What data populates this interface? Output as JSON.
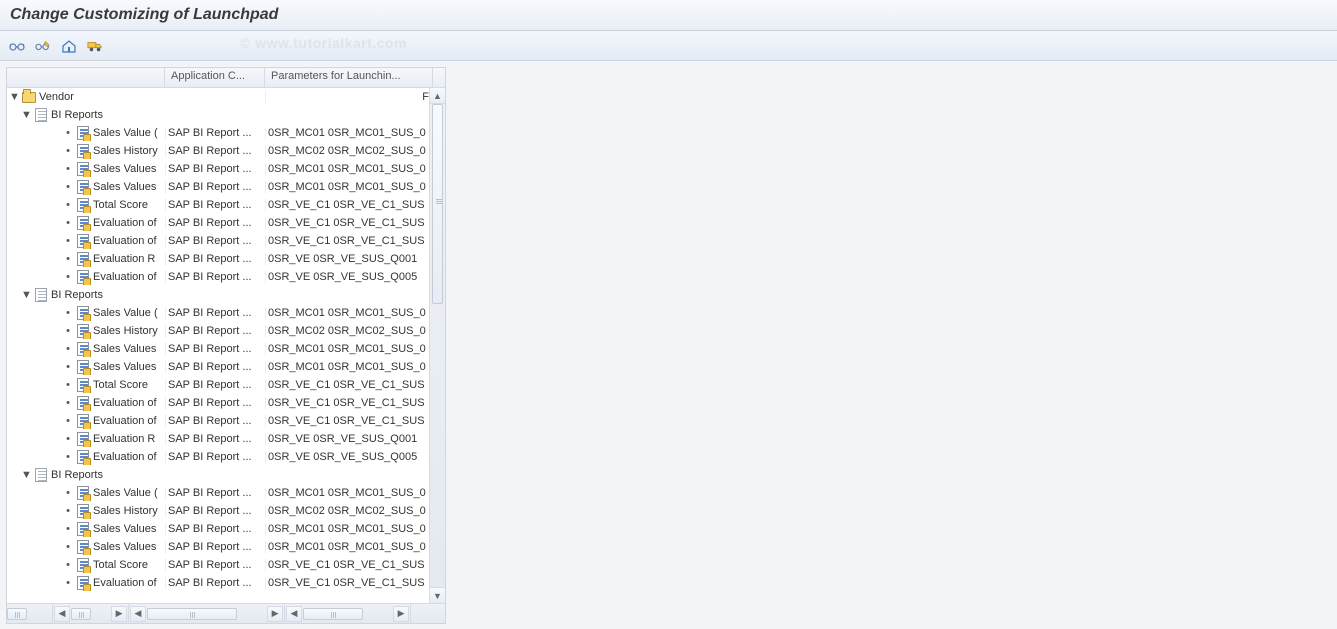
{
  "title": "Change Customizing of Launchpad",
  "watermark": "© www.tutorialkart.com",
  "toolbar_icons": [
    "glasses-icon",
    "glasses-pencil-icon",
    "house-icon",
    "truck-icon"
  ],
  "columns": {
    "c0": "",
    "c1": "Application C...",
    "c2": "Parameters for Launchin..."
  },
  "tree": {
    "root": {
      "label": "Vendor",
      "right": "F"
    },
    "groups": [
      {
        "label": "BI Reports",
        "items": [
          {
            "label": "Sales Value (",
            "app": "SAP BI Report ...",
            "param": "0SR_MC01 0SR_MC01_SUS_0"
          },
          {
            "label": "Sales History",
            "app": "SAP BI Report ...",
            "param": "0SR_MC02 0SR_MC02_SUS_0"
          },
          {
            "label": "Sales Values",
            "app": "SAP BI Report ...",
            "param": "0SR_MC01 0SR_MC01_SUS_0"
          },
          {
            "label": "Sales Values",
            "app": "SAP BI Report ...",
            "param": "0SR_MC01 0SR_MC01_SUS_0"
          },
          {
            "label": "Total Score",
            "app": "SAP BI Report ...",
            "param": "0SR_VE_C1 0SR_VE_C1_SUS"
          },
          {
            "label": "Evaluation of",
            "app": "SAP BI Report ...",
            "param": "0SR_VE_C1 0SR_VE_C1_SUS"
          },
          {
            "label": "Evaluation of",
            "app": "SAP BI Report ...",
            "param": "0SR_VE_C1 0SR_VE_C1_SUS"
          },
          {
            "label": "Evaluation R",
            "app": "SAP BI Report ...",
            "param": "0SR_VE 0SR_VE_SUS_Q001"
          },
          {
            "label": "Evaluation of",
            "app": "SAP BI Report ...",
            "param": "0SR_VE 0SR_VE_SUS_Q005"
          }
        ]
      },
      {
        "label": "BI Reports",
        "items": [
          {
            "label": "Sales Value (",
            "app": "SAP BI Report ...",
            "param": "0SR_MC01 0SR_MC01_SUS_0"
          },
          {
            "label": "Sales History",
            "app": "SAP BI Report ...",
            "param": "0SR_MC02 0SR_MC02_SUS_0"
          },
          {
            "label": "Sales Values",
            "app": "SAP BI Report ...",
            "param": "0SR_MC01 0SR_MC01_SUS_0"
          },
          {
            "label": "Sales Values",
            "app": "SAP BI Report ...",
            "param": "0SR_MC01 0SR_MC01_SUS_0"
          },
          {
            "label": "Total Score",
            "app": "SAP BI Report ...",
            "param": "0SR_VE_C1 0SR_VE_C1_SUS"
          },
          {
            "label": "Evaluation of",
            "app": "SAP BI Report ...",
            "param": "0SR_VE_C1 0SR_VE_C1_SUS"
          },
          {
            "label": "Evaluation of",
            "app": "SAP BI Report ...",
            "param": "0SR_VE_C1 0SR_VE_C1_SUS"
          },
          {
            "label": "Evaluation R",
            "app": "SAP BI Report ...",
            "param": "0SR_VE 0SR_VE_SUS_Q001"
          },
          {
            "label": "Evaluation of",
            "app": "SAP BI Report ...",
            "param": "0SR_VE 0SR_VE_SUS_Q005"
          }
        ]
      },
      {
        "label": "BI Reports",
        "items": [
          {
            "label": "Sales Value (",
            "app": "SAP BI Report ...",
            "param": "0SR_MC01 0SR_MC01_SUS_0"
          },
          {
            "label": "Sales History",
            "app": "SAP BI Report ...",
            "param": "0SR_MC02 0SR_MC02_SUS_0"
          },
          {
            "label": "Sales Values",
            "app": "SAP BI Report ...",
            "param": "0SR_MC01 0SR_MC01_SUS_0"
          },
          {
            "label": "Sales Values",
            "app": "SAP BI Report ...",
            "param": "0SR_MC01 0SR_MC01_SUS_0"
          },
          {
            "label": "Total Score",
            "app": "SAP BI Report ...",
            "param": "0SR_VE_C1 0SR_VE_C1_SUS"
          },
          {
            "label": "Evaluation of",
            "app": "SAP BI Report ...",
            "param": "0SR_VE_C1 0SR_VE_C1_SUS"
          }
        ]
      }
    ]
  }
}
